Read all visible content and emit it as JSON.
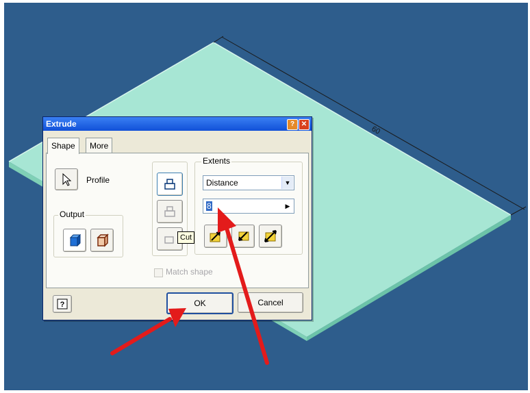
{
  "dialog": {
    "title": "Extrude",
    "tabs": [
      {
        "label": "Shape"
      },
      {
        "label": "More"
      }
    ],
    "profile_label": "Profile",
    "output_label": "Output",
    "extents": {
      "label": "Extents",
      "type_value": "Distance",
      "distance_value": "8"
    },
    "tooltip": "Cut",
    "match_shape_label": "Match shape",
    "ok_label": "OK",
    "cancel_label": "Cancel"
  },
  "scene": {
    "dimension_label": "60",
    "background_color": "#2e5d8c",
    "plate_color": "#a7e6d4"
  }
}
